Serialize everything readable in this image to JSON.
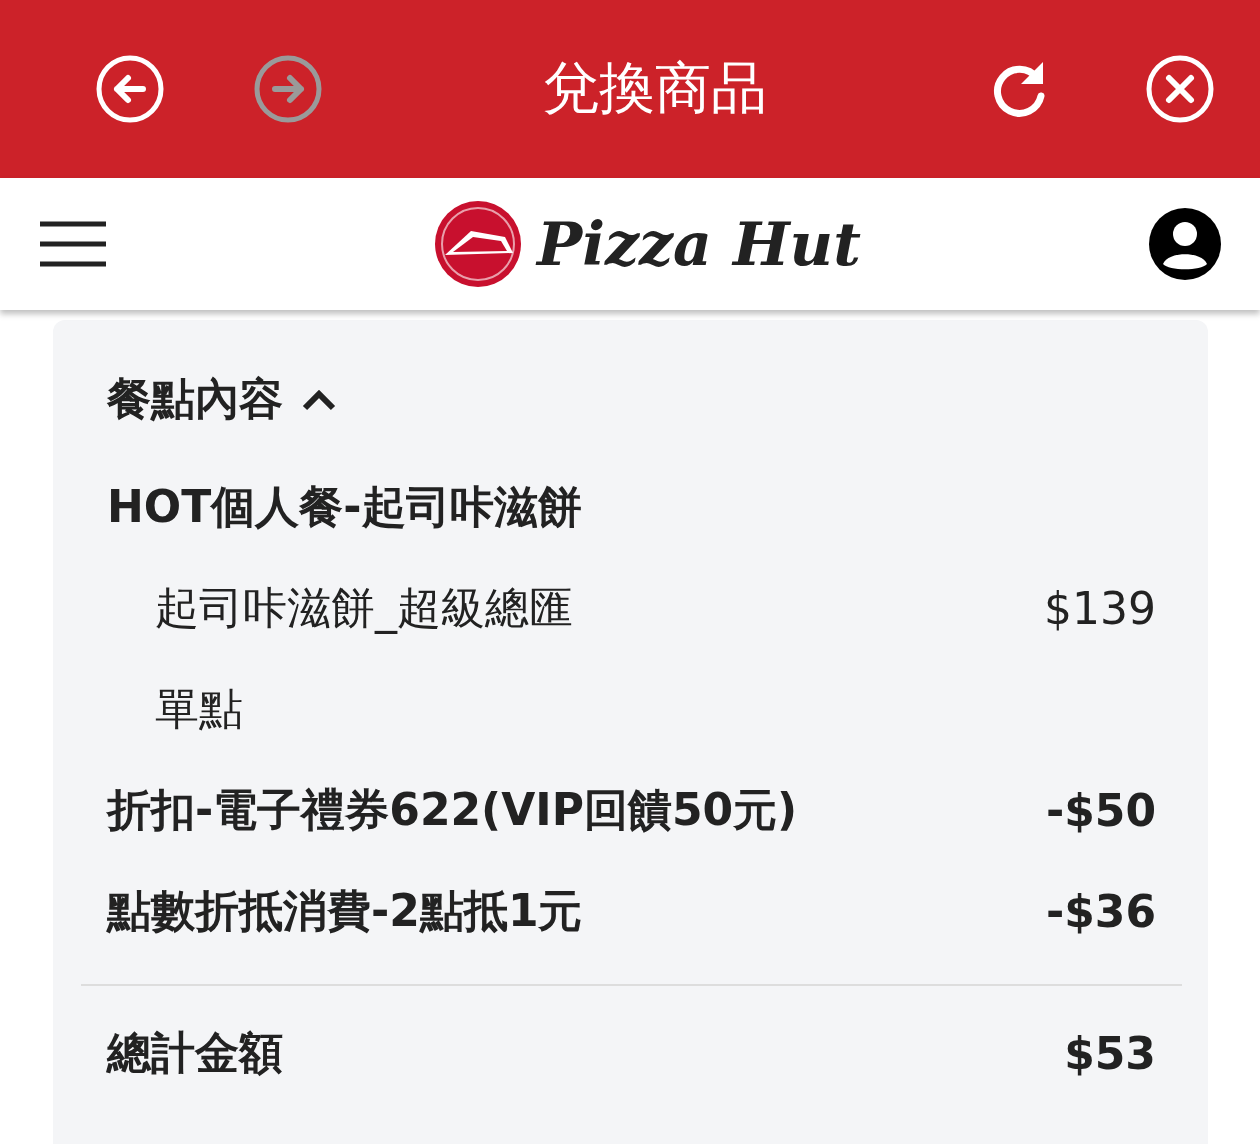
{
  "top_bar": {
    "title": "兌換商品",
    "buttons": [
      {
        "kind": "back",
        "disabled": false
      },
      {
        "kind": "forward",
        "disabled": true
      },
      {
        "kind": "reload",
        "disabled": false
      },
      {
        "kind": "close",
        "disabled": false
      }
    ]
  },
  "header": {
    "logo_text": "Pizza Hut"
  },
  "order": {
    "section_title": "餐點內容",
    "expanded": true,
    "items": [
      {
        "kind": "main",
        "name": "HOT個人餐-起司咔滋餅"
      },
      {
        "kind": "option",
        "name": "起司咔滋餅_超級總匯",
        "price": "$139"
      },
      {
        "kind": "option",
        "name": "單點"
      },
      {
        "kind": "main",
        "name": "折扣-電子禮券622(VIP回饋50元)",
        "price": "-$50"
      },
      {
        "kind": "main",
        "name": "點數折抵消費-2點抵1元",
        "price": "-$36"
      }
    ],
    "total": {
      "label": "總計金額",
      "amount": "$53"
    }
  }
}
